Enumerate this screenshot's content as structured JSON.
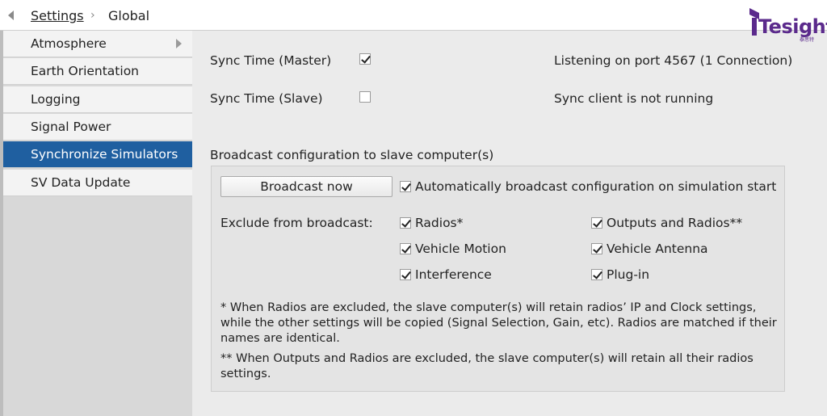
{
  "header": {
    "breadcrumb_settings": "Settings",
    "breadcrumb_separator": "›",
    "breadcrumb_current": "Global"
  },
  "logo": {
    "text": "Tesight",
    "subtext": "泰思特",
    "color": "#5b2a8c"
  },
  "sidebar": {
    "items": [
      {
        "label": "Atmosphere",
        "has_submenu": true
      },
      {
        "label": "Earth Orientation"
      },
      {
        "label": "Logging"
      },
      {
        "label": "Signal Power"
      },
      {
        "label": "Synchronize Simulators",
        "active": true
      },
      {
        "label": "SV Data Update"
      }
    ],
    "active_color": "#1f5fa0"
  },
  "sync": {
    "master_label": "Sync Time (Master)",
    "master_checked": true,
    "master_status": "Listening on port 4567 (1 Connection)",
    "slave_label": "Sync Time (Slave)",
    "slave_checked": false,
    "slave_status": "Sync client is not running"
  },
  "broadcast": {
    "section_title": "Broadcast configuration to slave computer(s)",
    "button_label": "Broadcast now",
    "auto_label": "Automatically broadcast configuration on simulation start",
    "auto_checked": true,
    "exclude_label": "Exclude from broadcast:",
    "exclude_items": [
      {
        "label": "Radios*",
        "checked": true
      },
      {
        "label": "Outputs and Radios**",
        "checked": true
      },
      {
        "label": "Vehicle Motion",
        "checked": true
      },
      {
        "label": "Vehicle Antenna",
        "checked": true
      },
      {
        "label": "Interference",
        "checked": true
      },
      {
        "label": "Plug-in",
        "checked": true
      }
    ],
    "note1": "* When Radios are excluded, the slave computer(s) will retain radios’ IP and Clock settings, while the other settings will be copied (Signal Selection, Gain, etc). Radios are matched if their names are identical.",
    "note2": "** When Outputs and Radios are excluded, the slave computer(s) will retain all their radios settings."
  }
}
